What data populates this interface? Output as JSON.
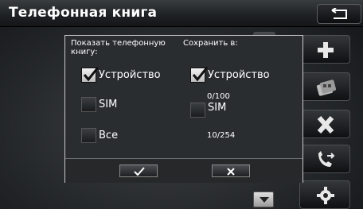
{
  "header": {
    "title": "Телефонная книга",
    "back_icon": "return-arrow-icon"
  },
  "toolbar": {
    "buttons": [
      {
        "icon": "add-plus-icon"
      },
      {
        "icon": "transfer-contacts-icon"
      },
      {
        "icon": "delete-x-icon"
      },
      {
        "icon": "phone-transfer-icon"
      },
      {
        "icon": "settings-gear-icon"
      }
    ]
  },
  "dialog": {
    "show_label": "Показать телефонную книгу:",
    "save_label": "Сохранить в:",
    "show_options": [
      {
        "label": "Устройство",
        "checked": true
      },
      {
        "label": "SIM",
        "checked": false
      },
      {
        "label": "Все",
        "checked": false
      }
    ],
    "save_options": [
      {
        "label": "Устройство",
        "checked": true
      },
      {
        "label": "SIM",
        "checked": false
      }
    ],
    "sim_count": "0/100",
    "all_count": "10/254",
    "ok_icon": "checkmark-icon",
    "cancel_icon": "close-icon"
  },
  "colors": {
    "dialog_bg": "#2a2d30",
    "dialog_border": "#c9c9c9",
    "checkbox_fill": "#e6e6e6"
  }
}
